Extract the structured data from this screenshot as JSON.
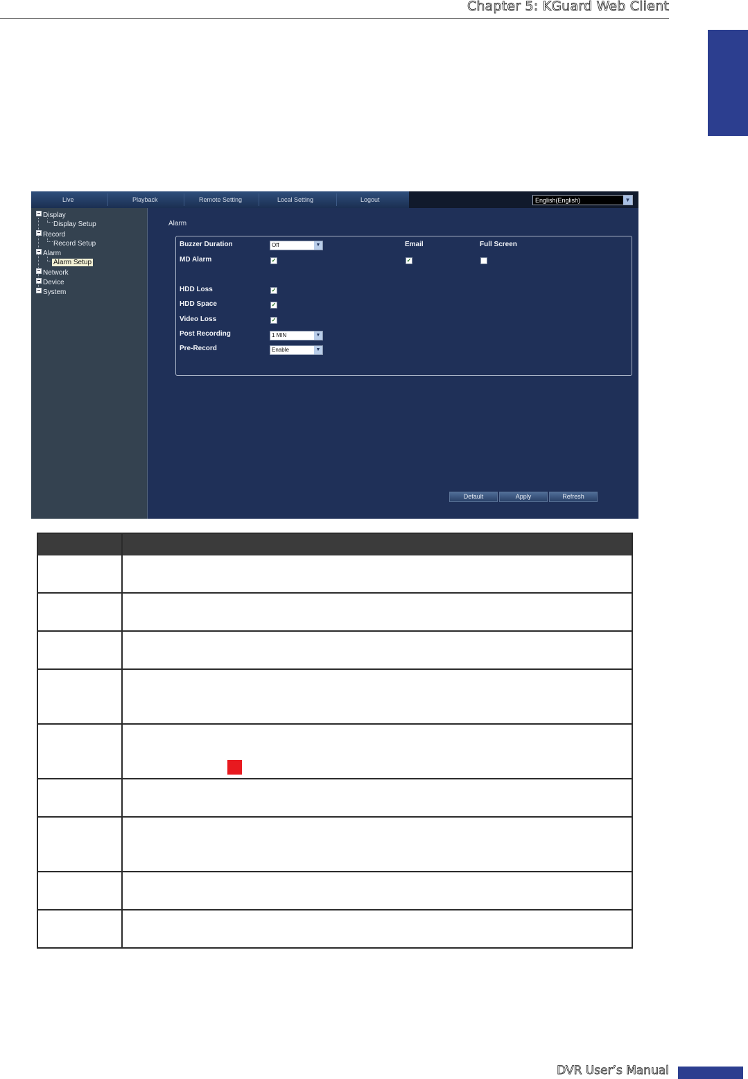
{
  "header": {
    "chapter": "Chapter 5: KGuard Web Client"
  },
  "footer": {
    "manual": "DVR User’s Manual"
  },
  "app": {
    "nav": [
      "Live",
      "Playback",
      "Remote Setting",
      "Local Setting",
      "Logout"
    ],
    "language": "English(English)",
    "tree": {
      "display": "Display",
      "display_setup": "Display Setup",
      "record": "Record",
      "record_setup": "Record Setup",
      "alarm": "Alarm",
      "alarm_setup": "Alarm Setup",
      "network": "Network",
      "device": "Device",
      "system": "System"
    },
    "panel_title": "Alarm",
    "form": {
      "buzzer_label": "Buzzer Duration",
      "buzzer_value": "Off",
      "email_label": "Email",
      "fullscreen_label": "Full Screen",
      "md_alarm_label": "MD Alarm",
      "hdd_loss_label": "HDD Loss",
      "hdd_space_label": "HDD Space",
      "video_loss_label": "Video Loss",
      "post_recording_label": "Post Recording",
      "post_recording_value": "1 MIN",
      "pre_record_label": "Pre-Record",
      "pre_record_value": "Enable",
      "checks": {
        "md_alarm": true,
        "email": true,
        "full_screen": false,
        "hdd_loss": true,
        "hdd_space": true,
        "video_loss": true
      }
    },
    "buttons": {
      "default": "Default",
      "apply": "Apply",
      "refresh": "Refresh"
    }
  },
  "colors": {
    "tab_blue": "#2c3e8f",
    "panel_bg": "#1f3058",
    "sidebar_bg": "#344250",
    "marker_red": "#e8191f"
  }
}
